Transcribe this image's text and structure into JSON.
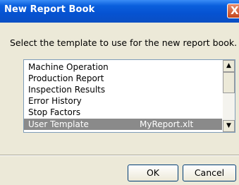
{
  "window": {
    "title": "New Report Book",
    "close_glyph": "X"
  },
  "instruction": "Select the template to use for the new report book.",
  "templates": [
    {
      "label": "Machine Operation",
      "file": ""
    },
    {
      "label": "Production Report",
      "file": ""
    },
    {
      "label": "Inspection Results",
      "file": ""
    },
    {
      "label": "Error History",
      "file": ""
    },
    {
      "label": "Stop Factors",
      "file": ""
    },
    {
      "label": "User Template",
      "file": "MyReport.xlt",
      "selected": true
    }
  ],
  "scrollbar": {
    "up": "▲",
    "down": "▼"
  },
  "buttons": {
    "ok": "OK",
    "cancel": "Cancel"
  },
  "colors": {
    "titlebar": "#0a5fdd",
    "selection": "#8a8a8a",
    "dialog_bg": "#ece9d8"
  }
}
